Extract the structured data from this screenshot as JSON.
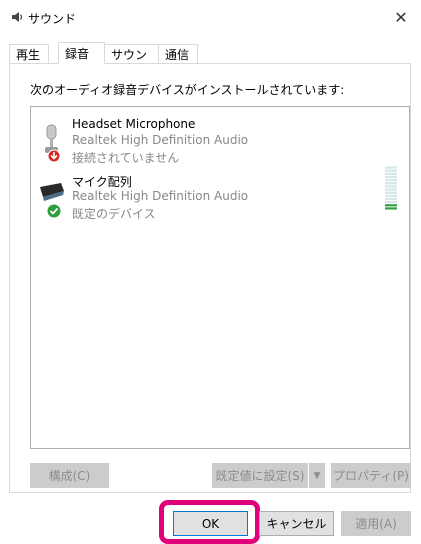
{
  "window": {
    "title": "サウンド"
  },
  "tabs": [
    {
      "label": "再生",
      "active": false
    },
    {
      "label": "録音",
      "active": true
    },
    {
      "label": "サウンド",
      "active": false
    },
    {
      "label": "通信",
      "active": false
    }
  ],
  "instruction": "次のオーディオ録音デバイスがインストールされています:",
  "devices": [
    {
      "name": "Headset Microphone",
      "driver": "Realtek High Definition Audio",
      "status": "接続されていません",
      "status_icon": "red-down-arrow-icon"
    },
    {
      "name": "マイク配列",
      "driver": "Realtek High Definition Audio",
      "status": "既定のデバイス",
      "status_icon": "green-check-icon",
      "level": 0.12
    }
  ],
  "buttons": {
    "configure": "構成(C)",
    "set_default": "既定値に設定(S)",
    "properties": "プロパティ(P)",
    "ok": "OK",
    "cancel": "キャンセル",
    "apply": "適用(A)"
  },
  "colors": {
    "accent": "#0078d7",
    "highlight_ring": "#e0007a",
    "level_green": "#2e9e3a"
  }
}
